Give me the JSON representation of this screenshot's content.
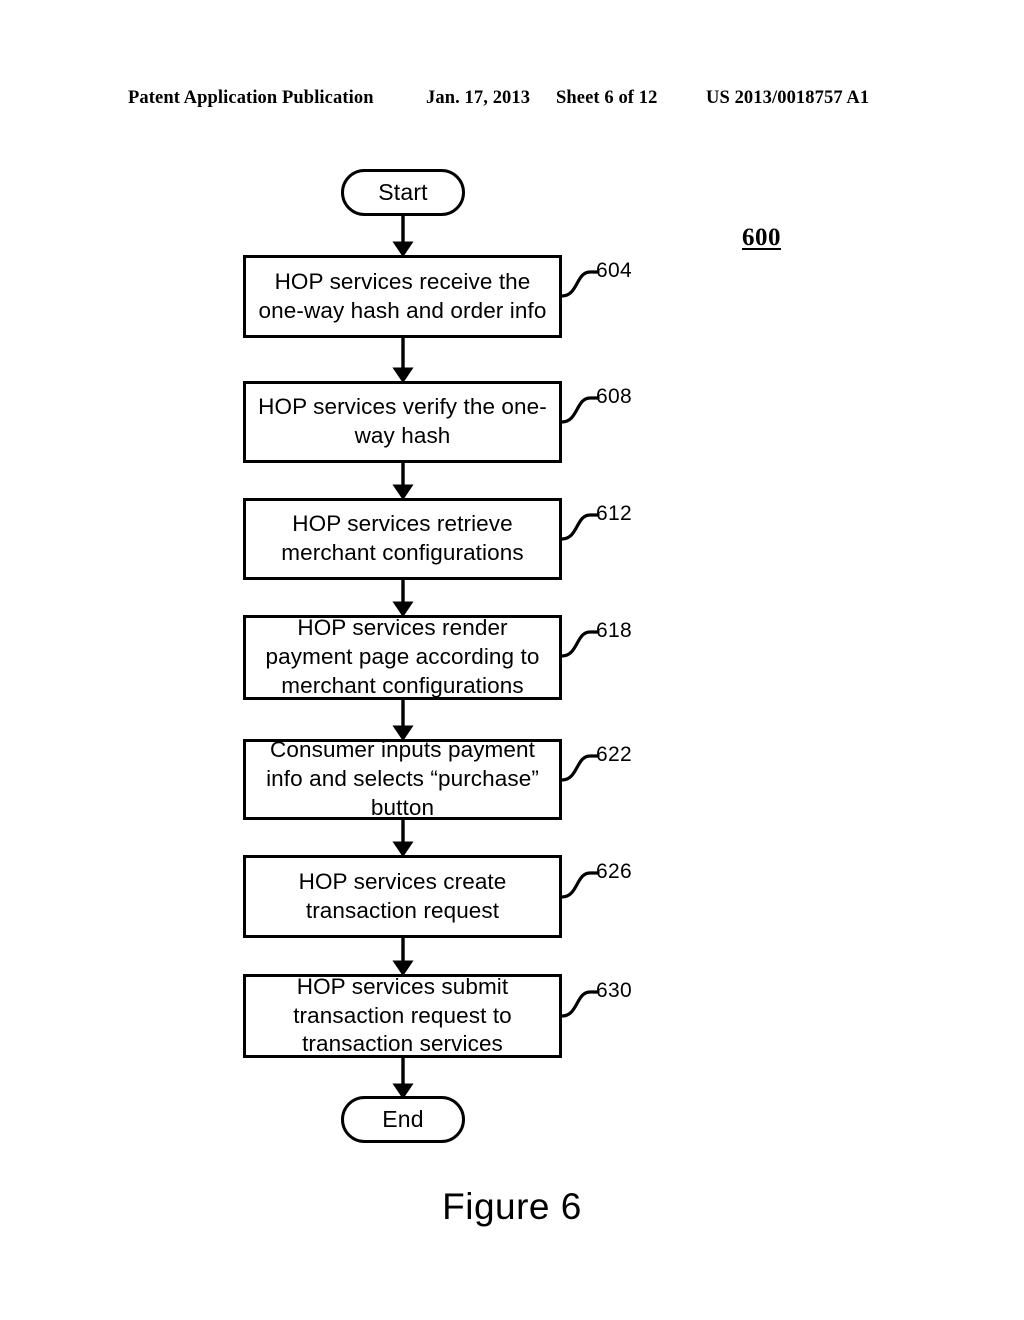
{
  "header": {
    "publication": "Patent Application Publication",
    "date": "Jan. 17, 2013",
    "sheet": "Sheet 6 of 12",
    "patent_number": "US 2013/0018757 A1"
  },
  "figure": {
    "reference_label": "600",
    "caption": "Figure 6"
  },
  "flowchart": {
    "start_label": "Start",
    "end_label": "End",
    "steps": [
      {
        "ref": "604",
        "text": "HOP services receive the one-way hash and order info"
      },
      {
        "ref": "608",
        "text": "HOP services verify the one-way hash"
      },
      {
        "ref": "612",
        "text": "HOP services retrieve merchant configurations"
      },
      {
        "ref": "618",
        "text": "HOP services render payment page according to merchant configurations"
      },
      {
        "ref": "622",
        "text": "Consumer inputs payment info and selects “purchase” button"
      },
      {
        "ref": "626",
        "text": "HOP services create transaction request"
      },
      {
        "ref": "630",
        "text": "HOP services submit transaction request to transaction services"
      }
    ]
  }
}
